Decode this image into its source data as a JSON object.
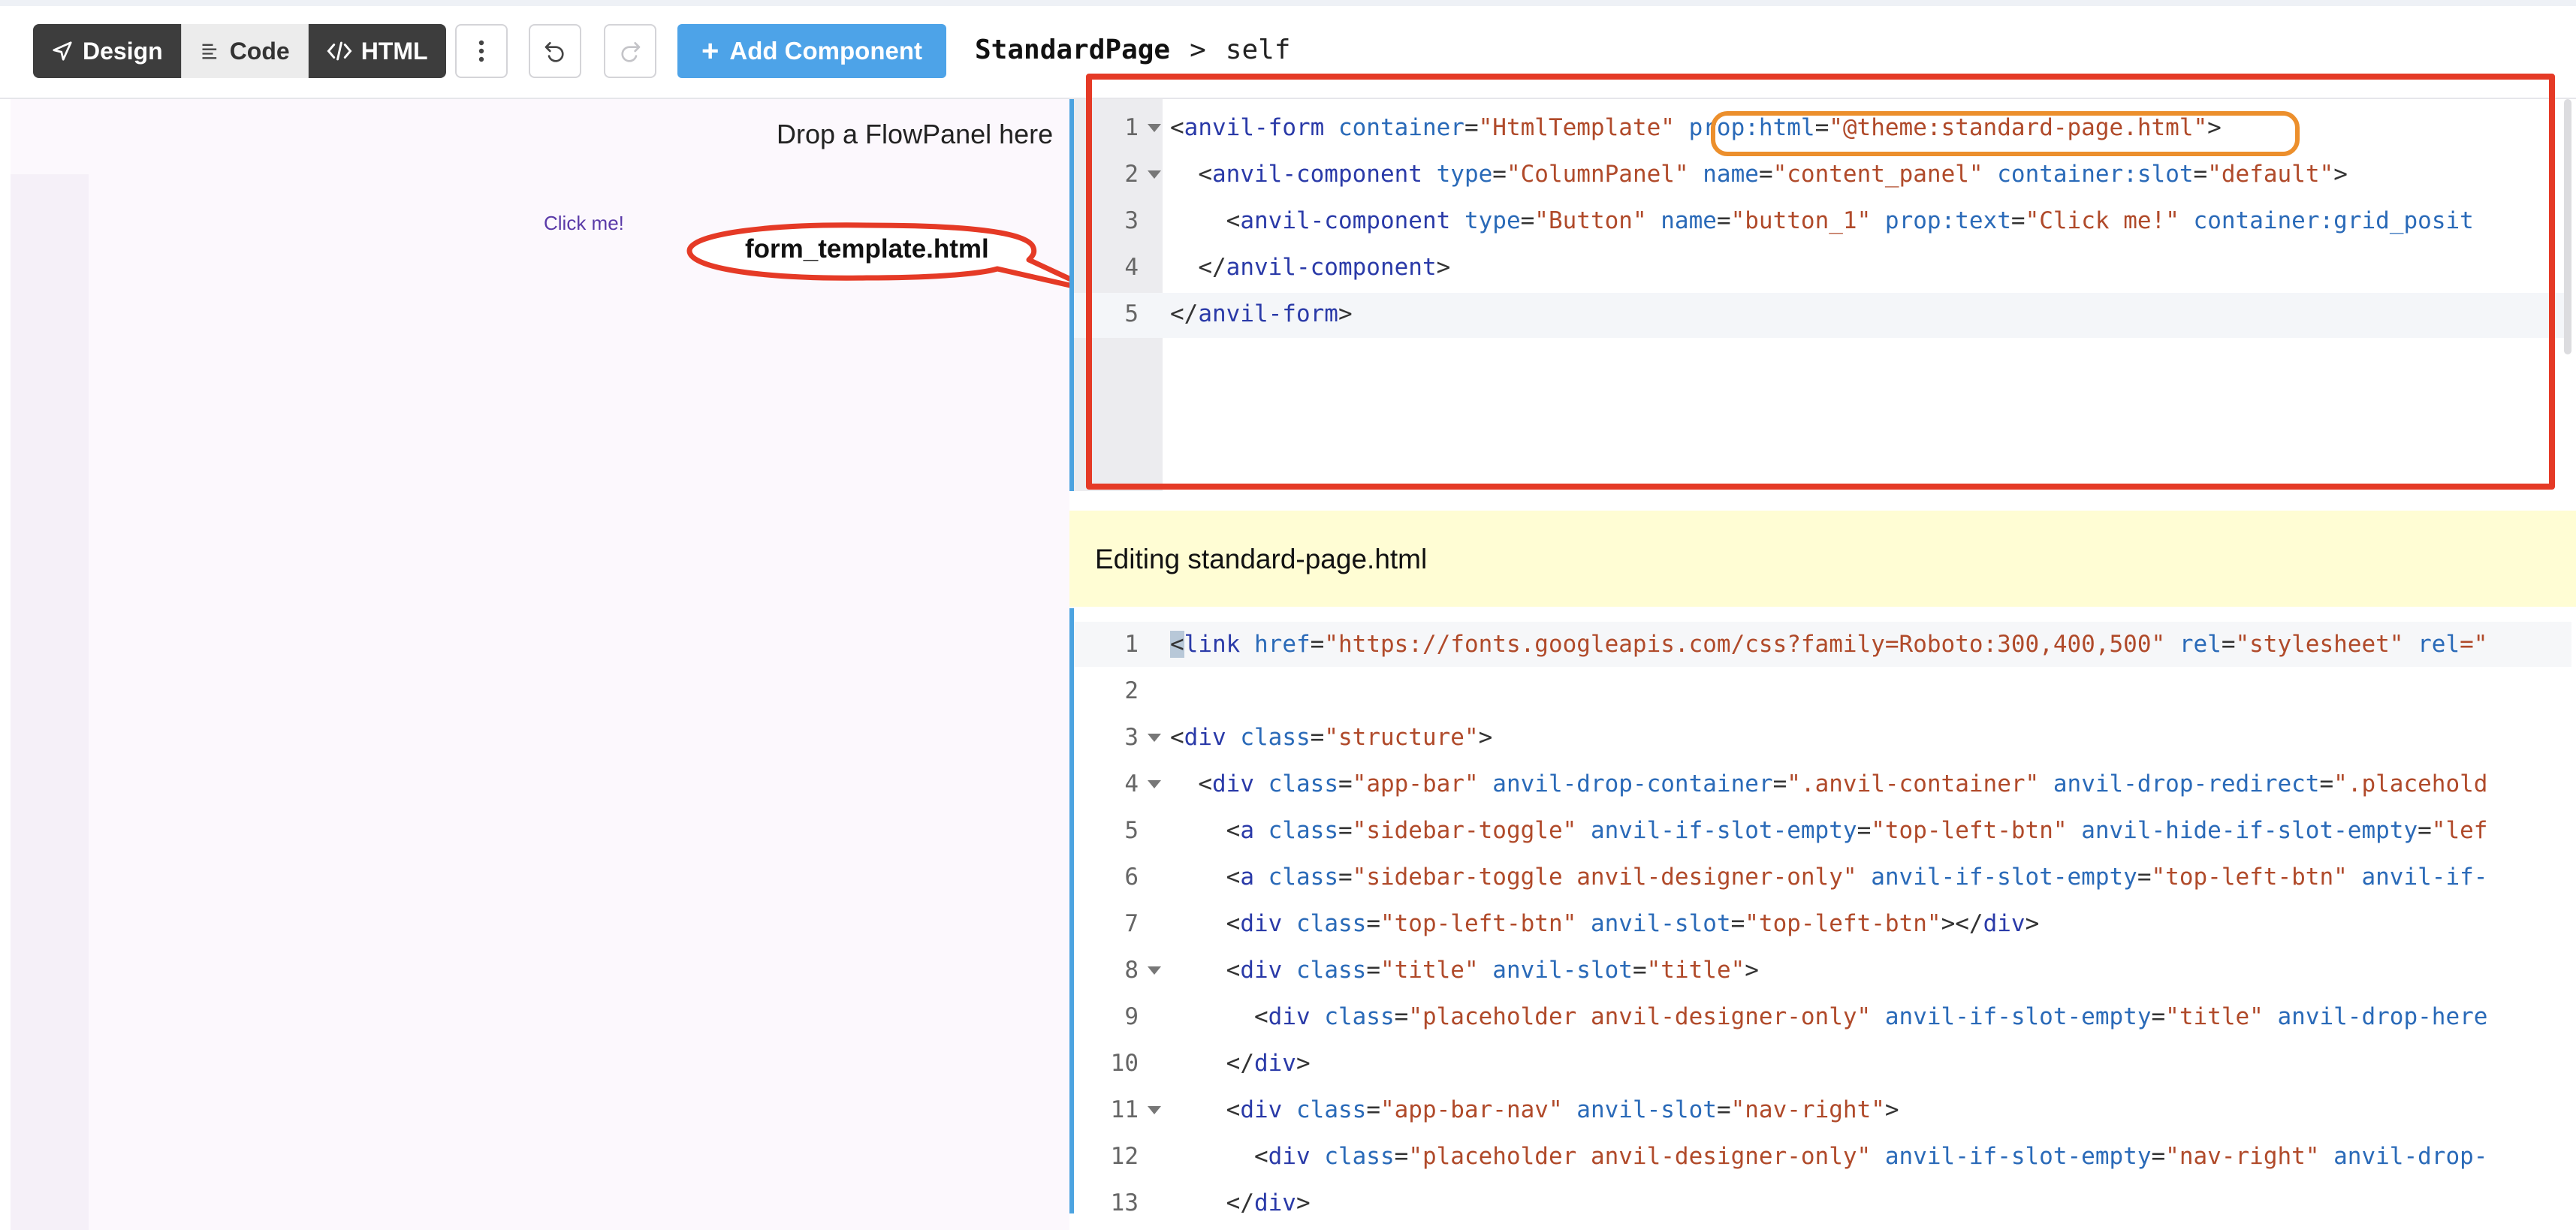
{
  "toolbar": {
    "design_label": "Design",
    "code_label": "Code",
    "html_label": "HTML",
    "add_component_label": "Add Component",
    "breadcrumb_form": "StandardPage",
    "breadcrumb_separator": ">",
    "breadcrumb_self": "self"
  },
  "canvas": {
    "drop_flowpanel": "Drop a FlowPanel here",
    "button_text": "Click me!",
    "callout_label": "form_template.html"
  },
  "form_editor": {
    "line_numbers": [
      "1",
      "2",
      "3",
      "4",
      "5"
    ],
    "lines": [
      {
        "indent": "",
        "tokens": [
          {
            "t": "<",
            "c": "t-txt"
          },
          {
            "t": "anvil-form",
            "c": "t-tag"
          },
          {
            "t": " container",
            "c": "t-attr"
          },
          {
            "t": "=",
            "c": "t-txt"
          },
          {
            "t": "\"HtmlTemplate\"",
            "c": "t-str"
          },
          {
            "t": " prop:html",
            "c": "t-attr"
          },
          {
            "t": "=",
            "c": "t-txt"
          },
          {
            "t": "\"@theme:standard-page.html\"",
            "c": "t-str"
          },
          {
            "t": ">",
            "c": "t-txt"
          }
        ]
      },
      {
        "indent": "  ",
        "tokens": [
          {
            "t": "<",
            "c": "t-txt"
          },
          {
            "t": "anvil-component",
            "c": "t-tag"
          },
          {
            "t": " type",
            "c": "t-attr"
          },
          {
            "t": "=",
            "c": "t-txt"
          },
          {
            "t": "\"ColumnPanel\"",
            "c": "t-str"
          },
          {
            "t": " name",
            "c": "t-attr"
          },
          {
            "t": "=",
            "c": "t-txt"
          },
          {
            "t": "\"content_panel\"",
            "c": "t-str"
          },
          {
            "t": " container:slot",
            "c": "t-attr"
          },
          {
            "t": "=",
            "c": "t-txt"
          },
          {
            "t": "\"default\"",
            "c": "t-str"
          },
          {
            "t": ">",
            "c": "t-txt"
          }
        ]
      },
      {
        "indent": "    ",
        "tokens": [
          {
            "t": "<",
            "c": "t-txt"
          },
          {
            "t": "anvil-component",
            "c": "t-tag"
          },
          {
            "t": " type",
            "c": "t-attr"
          },
          {
            "t": "=",
            "c": "t-txt"
          },
          {
            "t": "\"Button\"",
            "c": "t-str"
          },
          {
            "t": " name",
            "c": "t-attr"
          },
          {
            "t": "=",
            "c": "t-txt"
          },
          {
            "t": "\"button_1\"",
            "c": "t-str"
          },
          {
            "t": " prop:text",
            "c": "t-attr"
          },
          {
            "t": "=",
            "c": "t-txt"
          },
          {
            "t": "\"Click me!\"",
            "c": "t-str"
          },
          {
            "t": " container:grid_posit",
            "c": "t-attr"
          }
        ]
      },
      {
        "indent": "  ",
        "tokens": [
          {
            "t": "</",
            "c": "t-txt"
          },
          {
            "t": "anvil-component",
            "c": "t-tag"
          },
          {
            "t": ">",
            "c": "t-txt"
          }
        ]
      },
      {
        "indent": "",
        "tokens": [
          {
            "t": "</",
            "c": "t-txt"
          },
          {
            "t": "anvil-form",
            "c": "t-tag"
          },
          {
            "t": ">",
            "c": "t-txt"
          }
        ]
      }
    ]
  },
  "banner": {
    "text": "Editing standard-page.html"
  },
  "template_editor": {
    "line_numbers": [
      "1",
      "2",
      "3",
      "4",
      "5",
      "6",
      "7",
      "8",
      "9",
      "10",
      "11",
      "12",
      "13"
    ],
    "lines": [
      {
        "indent": "",
        "tokens": [
          {
            "t": "<",
            "c": "t-txt cursor"
          },
          {
            "t": "link",
            "c": "t-tag"
          },
          {
            "t": " href",
            "c": "t-attr"
          },
          {
            "t": "=",
            "c": "t-txt"
          },
          {
            "t": "\"https://fonts.googleapis.com/css?family=Roboto:300,400,500\"",
            "c": "t-str"
          },
          {
            "t": " rel",
            "c": "t-attr"
          },
          {
            "t": "=",
            "c": "t-txt"
          },
          {
            "t": "\"stylesheet\"",
            "c": "t-str"
          },
          {
            "t": " rel",
            "c": "t-attr"
          },
          {
            "t": "=\"",
            "c": "t-str"
          }
        ]
      },
      {
        "indent": "",
        "tokens": []
      },
      {
        "indent": "",
        "tokens": [
          {
            "t": "<",
            "c": "t-txt"
          },
          {
            "t": "div",
            "c": "t-tag"
          },
          {
            "t": " class",
            "c": "t-attr"
          },
          {
            "t": "=",
            "c": "t-txt"
          },
          {
            "t": "\"structure\"",
            "c": "t-str"
          },
          {
            "t": ">",
            "c": "t-txt"
          }
        ]
      },
      {
        "indent": "  ",
        "tokens": [
          {
            "t": "<",
            "c": "t-txt"
          },
          {
            "t": "div",
            "c": "t-tag"
          },
          {
            "t": " class",
            "c": "t-attr"
          },
          {
            "t": "=",
            "c": "t-txt"
          },
          {
            "t": "\"app-bar\"",
            "c": "t-str"
          },
          {
            "t": " anvil-drop-container",
            "c": "t-attr"
          },
          {
            "t": "=",
            "c": "t-txt"
          },
          {
            "t": "\".anvil-container\"",
            "c": "t-str"
          },
          {
            "t": " anvil-drop-redirect",
            "c": "t-attr"
          },
          {
            "t": "=",
            "c": "t-txt"
          },
          {
            "t": "\".placehold",
            "c": "t-str"
          }
        ]
      },
      {
        "indent": "    ",
        "tokens": [
          {
            "t": "<",
            "c": "t-txt"
          },
          {
            "t": "a",
            "c": "t-tag"
          },
          {
            "t": " class",
            "c": "t-attr"
          },
          {
            "t": "=",
            "c": "t-txt"
          },
          {
            "t": "\"sidebar-toggle\"",
            "c": "t-str"
          },
          {
            "t": " anvil-if-slot-empty",
            "c": "t-attr"
          },
          {
            "t": "=",
            "c": "t-txt"
          },
          {
            "t": "\"top-left-btn\"",
            "c": "t-str"
          },
          {
            "t": " anvil-hide-if-slot-empty",
            "c": "t-attr"
          },
          {
            "t": "=",
            "c": "t-txt"
          },
          {
            "t": "\"lef",
            "c": "t-str"
          }
        ]
      },
      {
        "indent": "    ",
        "tokens": [
          {
            "t": "<",
            "c": "t-txt"
          },
          {
            "t": "a",
            "c": "t-tag"
          },
          {
            "t": " class",
            "c": "t-attr"
          },
          {
            "t": "=",
            "c": "t-txt"
          },
          {
            "t": "\"sidebar-toggle anvil-designer-only\"",
            "c": "t-str"
          },
          {
            "t": " anvil-if-slot-empty",
            "c": "t-attr"
          },
          {
            "t": "=",
            "c": "t-txt"
          },
          {
            "t": "\"top-left-btn\"",
            "c": "t-str"
          },
          {
            "t": " anvil-if-",
            "c": "t-attr"
          }
        ]
      },
      {
        "indent": "    ",
        "tokens": [
          {
            "t": "<",
            "c": "t-txt"
          },
          {
            "t": "div",
            "c": "t-tag"
          },
          {
            "t": " class",
            "c": "t-attr"
          },
          {
            "t": "=",
            "c": "t-txt"
          },
          {
            "t": "\"top-left-btn\"",
            "c": "t-str"
          },
          {
            "t": " anvil-slot",
            "c": "t-attr"
          },
          {
            "t": "=",
            "c": "t-txt"
          },
          {
            "t": "\"top-left-btn\"",
            "c": "t-str"
          },
          {
            "t": "></",
            "c": "t-txt"
          },
          {
            "t": "div",
            "c": "t-tag"
          },
          {
            "t": ">",
            "c": "t-txt"
          }
        ]
      },
      {
        "indent": "    ",
        "tokens": [
          {
            "t": "<",
            "c": "t-txt"
          },
          {
            "t": "div",
            "c": "t-tag"
          },
          {
            "t": " class",
            "c": "t-attr"
          },
          {
            "t": "=",
            "c": "t-txt"
          },
          {
            "t": "\"title\"",
            "c": "t-str"
          },
          {
            "t": " anvil-slot",
            "c": "t-attr"
          },
          {
            "t": "=",
            "c": "t-txt"
          },
          {
            "t": "\"title\"",
            "c": "t-str"
          },
          {
            "t": ">",
            "c": "t-txt"
          }
        ]
      },
      {
        "indent": "      ",
        "tokens": [
          {
            "t": "<",
            "c": "t-txt"
          },
          {
            "t": "div",
            "c": "t-tag"
          },
          {
            "t": " class",
            "c": "t-attr"
          },
          {
            "t": "=",
            "c": "t-txt"
          },
          {
            "t": "\"placeholder anvil-designer-only\"",
            "c": "t-str"
          },
          {
            "t": " anvil-if-slot-empty",
            "c": "t-attr"
          },
          {
            "t": "=",
            "c": "t-txt"
          },
          {
            "t": "\"title\"",
            "c": "t-str"
          },
          {
            "t": " anvil-drop-here",
            "c": "t-attr"
          }
        ]
      },
      {
        "indent": "    ",
        "tokens": [
          {
            "t": "</",
            "c": "t-txt"
          },
          {
            "t": "div",
            "c": "t-tag"
          },
          {
            "t": ">",
            "c": "t-txt"
          }
        ]
      },
      {
        "indent": "    ",
        "tokens": [
          {
            "t": "<",
            "c": "t-txt"
          },
          {
            "t": "div",
            "c": "t-tag"
          },
          {
            "t": " class",
            "c": "t-attr"
          },
          {
            "t": "=",
            "c": "t-txt"
          },
          {
            "t": "\"app-bar-nav\"",
            "c": "t-str"
          },
          {
            "t": " anvil-slot",
            "c": "t-attr"
          },
          {
            "t": "=",
            "c": "t-txt"
          },
          {
            "t": "\"nav-right\"",
            "c": "t-str"
          },
          {
            "t": ">",
            "c": "t-txt"
          }
        ]
      },
      {
        "indent": "      ",
        "tokens": [
          {
            "t": "<",
            "c": "t-txt"
          },
          {
            "t": "div",
            "c": "t-tag"
          },
          {
            "t": " class",
            "c": "t-attr"
          },
          {
            "t": "=",
            "c": "t-txt"
          },
          {
            "t": "\"placeholder anvil-designer-only\"",
            "c": "t-str"
          },
          {
            "t": " anvil-if-slot-empty",
            "c": "t-attr"
          },
          {
            "t": "=",
            "c": "t-txt"
          },
          {
            "t": "\"nav-right\"",
            "c": "t-str"
          },
          {
            "t": " anvil-drop-",
            "c": "t-attr"
          }
        ]
      },
      {
        "indent": "    ",
        "tokens": [
          {
            "t": "</",
            "c": "t-txt"
          },
          {
            "t": "div",
            "c": "t-tag"
          },
          {
            "t": ">",
            "c": "t-txt"
          }
        ]
      }
    ]
  },
  "colors": {
    "toolbar_dark": "#3d3d3d",
    "accent_blue": "#4da3e8",
    "callout_red": "#e53a26",
    "highlight_orange": "#ec8f2c",
    "banner_yellow": "#fffdd4"
  }
}
